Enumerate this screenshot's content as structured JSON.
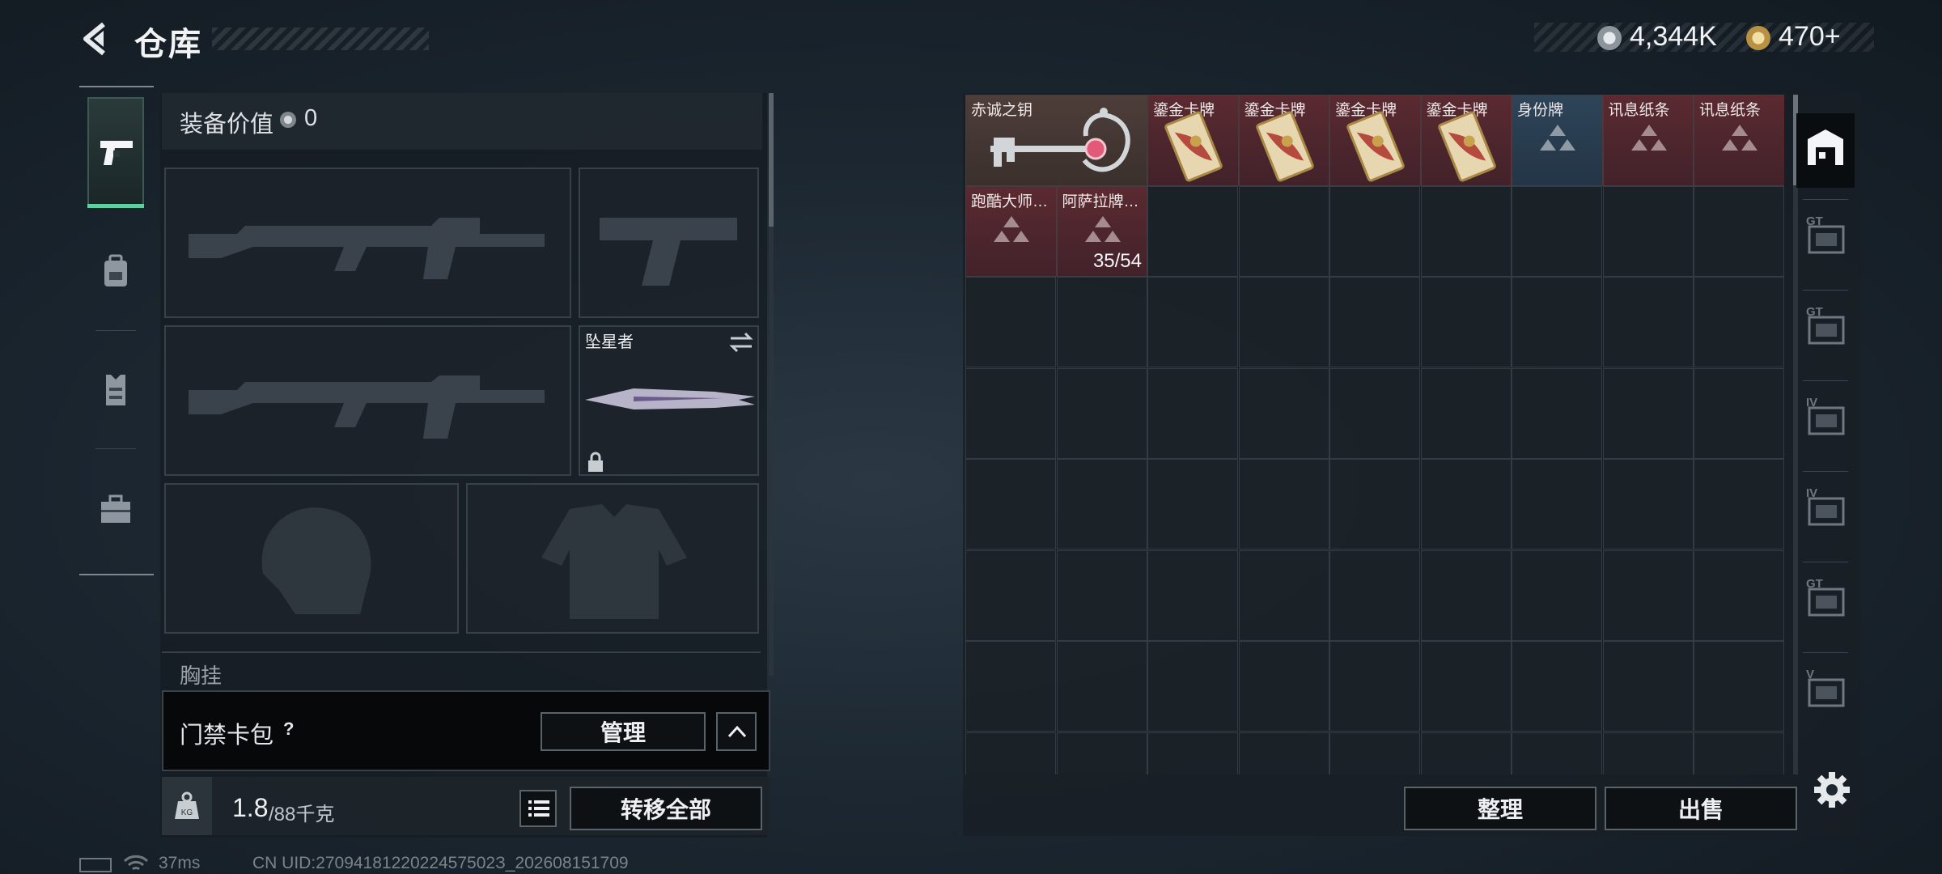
{
  "header": {
    "title": "仓库",
    "back_icon": "back-arrow-icon",
    "currencies": [
      {
        "icon": "coin-silver-icon",
        "color": "#b9bfc4",
        "value": "4,344K"
      },
      {
        "icon": "coin-gold-icon",
        "color": "#c9a657",
        "value": "470+"
      }
    ]
  },
  "nav": {
    "items": [
      {
        "name": "weapons",
        "icon": "pistol-icon",
        "active": true
      },
      {
        "name": "backpack",
        "icon": "backpack-icon",
        "active": false
      },
      {
        "name": "vest",
        "icon": "vest-icon",
        "active": false
      },
      {
        "name": "toolbox",
        "icon": "toolbox-icon",
        "active": false
      }
    ]
  },
  "loadout": {
    "value_label": "装备价值",
    "value": "0",
    "melee_name": "坠星者",
    "chest_label": "胸挂",
    "card_pack_label": "门禁卡包",
    "card_help": "?",
    "manage_label": "管理",
    "weight": "1.8",
    "weight_max": "/88千克",
    "transfer_all_label": "转移全部"
  },
  "stash": {
    "items": [
      {
        "name": "赤诚之钥",
        "count": "",
        "color": "red",
        "icon": "key-icon"
      },
      {
        "name": "鎏金卡牌",
        "count": "",
        "color": "red",
        "icon": "card-icon"
      },
      {
        "name": "鎏金卡牌",
        "count": "",
        "color": "red",
        "icon": "card-icon"
      },
      {
        "name": "鎏金卡牌",
        "count": "",
        "color": "red",
        "icon": "card-icon"
      },
      {
        "name": "鎏金卡牌",
        "count": "",
        "color": "red",
        "icon": "card-icon"
      },
      {
        "name": "身份牌",
        "count": "",
        "color": "blue",
        "icon": "triangle-icon"
      },
      {
        "name": "讯息纸条",
        "count": "",
        "color": "red",
        "icon": "triangle-icon"
      },
      {
        "name": "讯息纸条",
        "count": "",
        "color": "red",
        "icon": "triangle-icon"
      },
      {
        "name": "跑酷大师…",
        "count": "",
        "color": "red",
        "icon": "triangle-icon"
      },
      {
        "name": "阿萨拉牌…",
        "count": "35/54",
        "color": "red",
        "icon": "triangle-icon"
      }
    ],
    "sort_label": "整理",
    "sell_label": "出售",
    "side_tabs": [
      "stash-icon",
      "gt-case-icon",
      "gt-rifle-icon",
      "iv-folder-icon",
      "iv-medkit-icon",
      "gt-box-icon",
      "v-safe-icon"
    ]
  },
  "status_bar": {
    "ping": "37ms",
    "uid": "CN UID:2709418122022457502З_202608151709"
  }
}
